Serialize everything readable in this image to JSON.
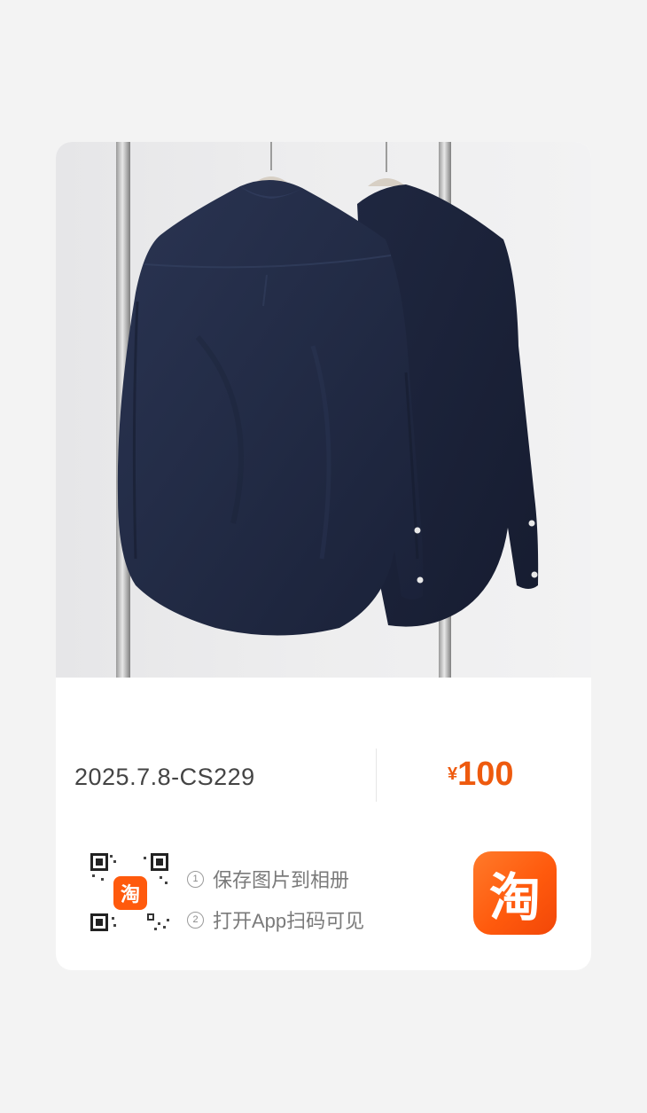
{
  "product": {
    "code": "2025.7.8-CS229",
    "price_currency": "¥",
    "price_amount": "100",
    "image_icon": "navy-shirts-photo"
  },
  "instructions": {
    "step1_num": "①",
    "step1_text": "保存图片到相册",
    "step2_num": "②",
    "step2_text": "打开App扫码可见"
  },
  "qr": {
    "icon": "qr-code-icon",
    "badge_char": "淘"
  },
  "app_icon": {
    "icon": "taobao-app-icon",
    "char": "淘"
  },
  "colors": {
    "price": "#ee5a0e",
    "brand_orange": "#ff5a0d",
    "shirt": "#1e2840",
    "card_bg": "#ffffff",
    "page_bg": "#f3f3f3"
  }
}
